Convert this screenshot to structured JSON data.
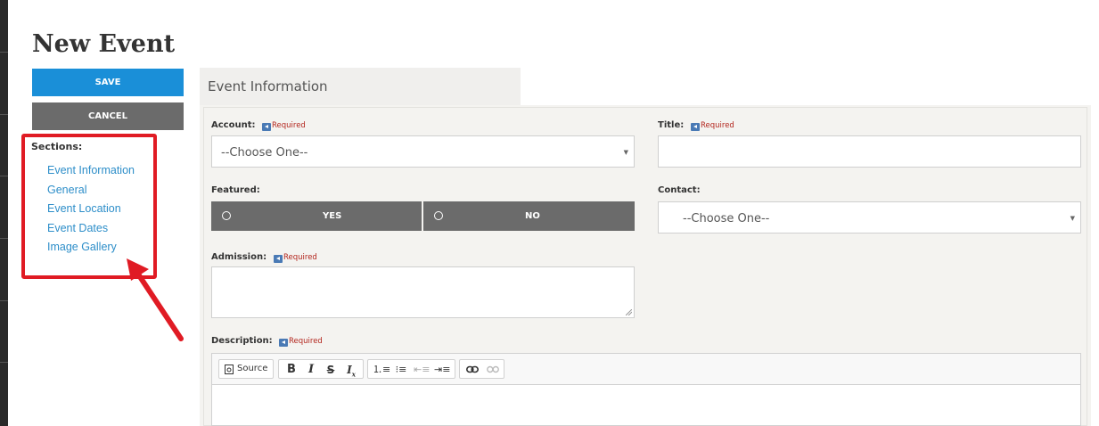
{
  "page": {
    "title": "New Event"
  },
  "actions": {
    "save_label": "SAVE",
    "cancel_label": "CANCEL"
  },
  "sections": {
    "label": "Sections:",
    "items": [
      "Event Information",
      "General",
      "Event Location",
      "Event Dates",
      "Image Gallery"
    ]
  },
  "tab": {
    "label": "Event Information"
  },
  "form": {
    "required_text": "Required",
    "account": {
      "label": "Account:",
      "value": "--Choose One--"
    },
    "title": {
      "label": "Title:",
      "value": ""
    },
    "featured": {
      "label": "Featured:",
      "yes_label": "YES",
      "no_label": "NO"
    },
    "contact": {
      "label": "Contact:",
      "value": "--Choose One--"
    },
    "admission": {
      "label": "Admission:",
      "value": ""
    },
    "description": {
      "label": "Description:",
      "source_label": "Source"
    }
  },
  "toolbar_icons": [
    "source-icon",
    "bold-icon",
    "italic-icon",
    "strikethrough-icon",
    "remove-format-icon",
    "numbered-list-icon",
    "bulleted-list-icon",
    "outdent-icon",
    "indent-icon",
    "link-icon",
    "unlink-icon"
  ],
  "colors": {
    "save": "#1a8fd8",
    "cancel": "#6b6b6b",
    "link": "#2d8ec9",
    "required": "#b3261e",
    "highlight": "#e01b24",
    "panel": "#f4f3f0"
  }
}
